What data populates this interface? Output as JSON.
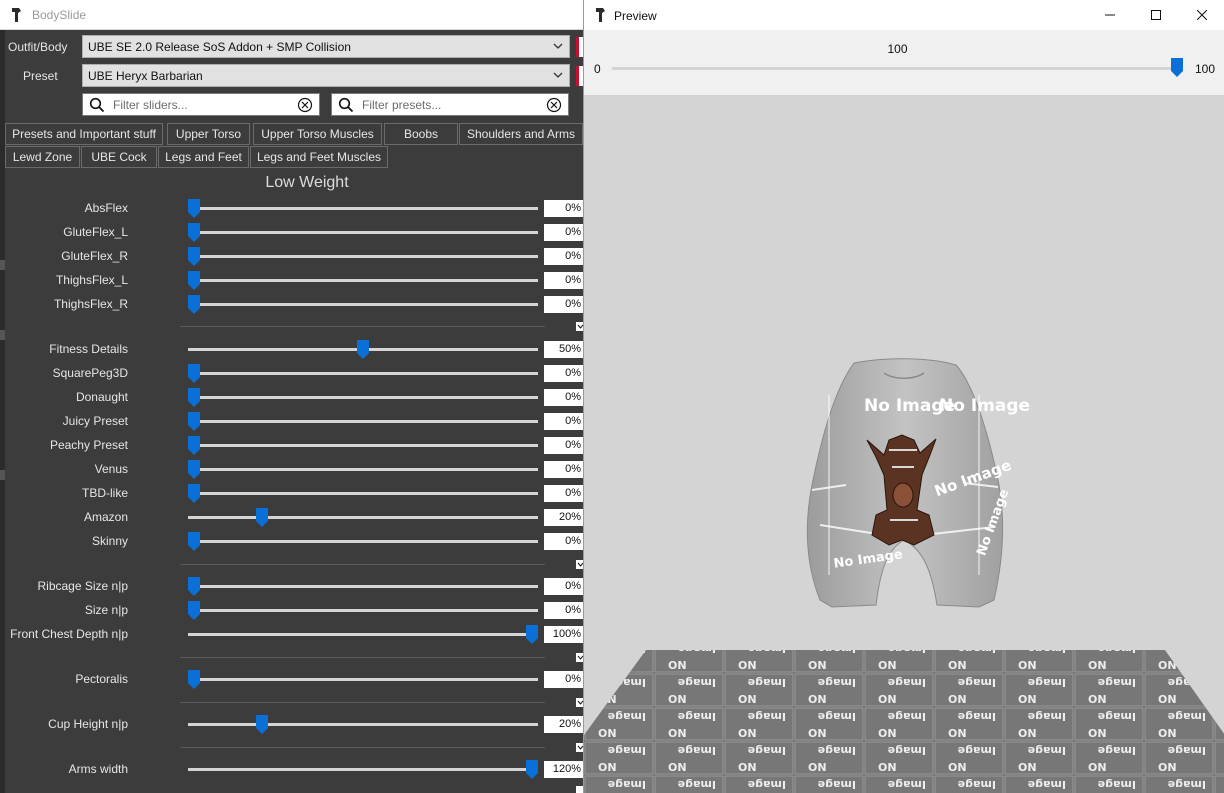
{
  "bodyslide": {
    "title": "BodySlide",
    "outfit_label": "Outfit/Body",
    "outfit_value": "UBE SE 2.0 Release SoS Addon + SMP Collision",
    "preset_label": "Preset",
    "preset_value": "UBE Heryx Barbarian",
    "filter_sliders_placeholder": "Filter sliders...",
    "filter_presets_placeholder": "Filter presets...",
    "tabs_row1": [
      "Presets and Important stuff",
      "Upper Torso",
      "Upper Torso Muscles",
      "Boobs",
      "Shoulders and Arms"
    ],
    "tabs_row2": [
      "Lewd Zone",
      "UBE Cock",
      "Legs and Feet",
      "Legs and Feet Muscles"
    ],
    "section_title": "Low Weight",
    "sliders": [
      {
        "label": "AbsFlex",
        "value": "0%",
        "level": 0
      },
      {
        "label": "GluteFlex_L",
        "value": "0%",
        "level": 0
      },
      {
        "label": "GluteFlex_R",
        "value": "0%",
        "level": 0
      },
      {
        "label": "ThighsFlex_L",
        "value": "0%",
        "level": 0
      },
      {
        "label": "ThighsFlex_R",
        "value": "0%",
        "level": 0
      },
      {
        "label": "Fitness Details",
        "value": "50%",
        "level": 50
      },
      {
        "label": "SquarePeg3D",
        "value": "0%",
        "level": 0
      },
      {
        "label": "Donaught",
        "value": "0%",
        "level": 0
      },
      {
        "label": "Juicy Preset",
        "value": "0%",
        "level": 0
      },
      {
        "label": "Peachy Preset",
        "value": "0%",
        "level": 0
      },
      {
        "label": "Venus",
        "value": "0%",
        "level": 0
      },
      {
        "label": "TBD-like",
        "value": "0%",
        "level": 0
      },
      {
        "label": "Amazon",
        "value": "20%",
        "level": 20
      },
      {
        "label": "Skinny",
        "value": "0%",
        "level": 0
      },
      {
        "label": "Ribcage Size n|p",
        "value": "0%",
        "level": 0
      },
      {
        "label": "Size n|p",
        "value": "0%",
        "level": 0
      },
      {
        "label": "Front Chest Depth n|p",
        "value": "100%",
        "level": 100
      },
      {
        "label": "Pectoralis",
        "value": "0%",
        "level": 0
      },
      {
        "label": "Cup Height n|p",
        "value": "20%",
        "level": 20
      },
      {
        "label": "Arms width",
        "value": "120%",
        "level": 100
      }
    ]
  },
  "preview": {
    "title": "Preview",
    "slider_current": "100",
    "slider_min": "0",
    "slider_max": "100",
    "slider_level": 100,
    "texture_text": "No Image"
  },
  "colors": {
    "accent": "#0a6fd6",
    "panel_bg": "#3c3c3c",
    "preview_bg": "#d4d4d4",
    "model_gray": "#b3b3b3"
  }
}
